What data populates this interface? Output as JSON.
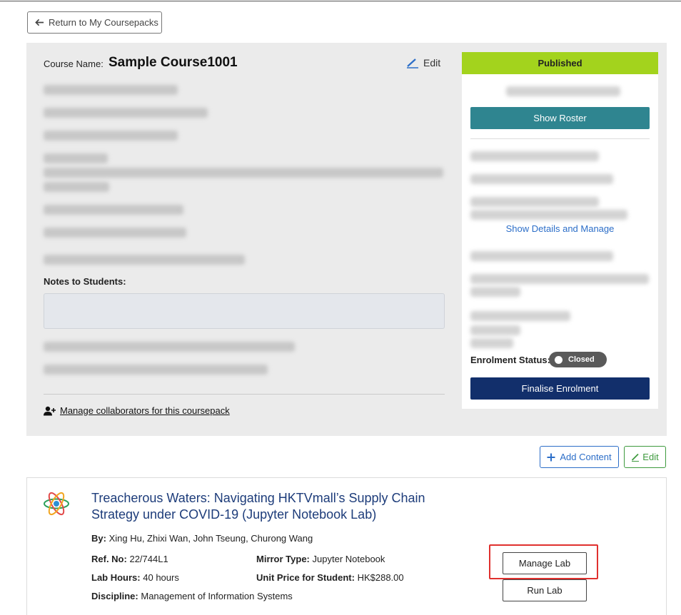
{
  "nav": {
    "return_label": "Return to My Coursepacks"
  },
  "course": {
    "name_label": "Course Name:",
    "name": "Sample Course1001",
    "edit_label": "Edit",
    "notes_label": "Notes to Students:",
    "notes_value": "",
    "collaborators_label": "Manage collaborators for this coursepack"
  },
  "side": {
    "status": "Published",
    "status_color": "#a3d31d",
    "show_roster": "Show Roster",
    "show_details": "Show Details and Manage",
    "enrolment_label": "Enrolment Status:",
    "enrolment_toggle": "Closed",
    "finalise": "Finalise Enrolment"
  },
  "actions": {
    "add_content": "Add Content",
    "edit": "Edit"
  },
  "item": {
    "title": "Treacherous Waters: Navigating HKTVmall’s Supply Chain Strategy under COVID-19 (Jupyter Notebook Lab)",
    "by_label": "By:",
    "authors": "Xing Hu, Zhixi Wan, John Tseung, Churong Wang",
    "ref_label": "Ref. No:",
    "ref": "22/744L1",
    "mirror_label": "Mirror Type:",
    "mirror": "Jupyter Notebook",
    "hours_label": "Lab Hours:",
    "hours": "40 hours",
    "price_label": "Unit Price for Student:",
    "price": "HK$288.00",
    "discipline_label": "Discipline:",
    "discipline": "Management of Information Systems",
    "manage_lab": "Manage Lab",
    "run_lab": "Run Lab"
  },
  "colors": {
    "roster_button": "#2f8590",
    "finalise_button": "#122f6b",
    "link_blue": "#2c6ec8",
    "edit_green": "#3e9a3e",
    "highlight_red": "#e0302e"
  }
}
